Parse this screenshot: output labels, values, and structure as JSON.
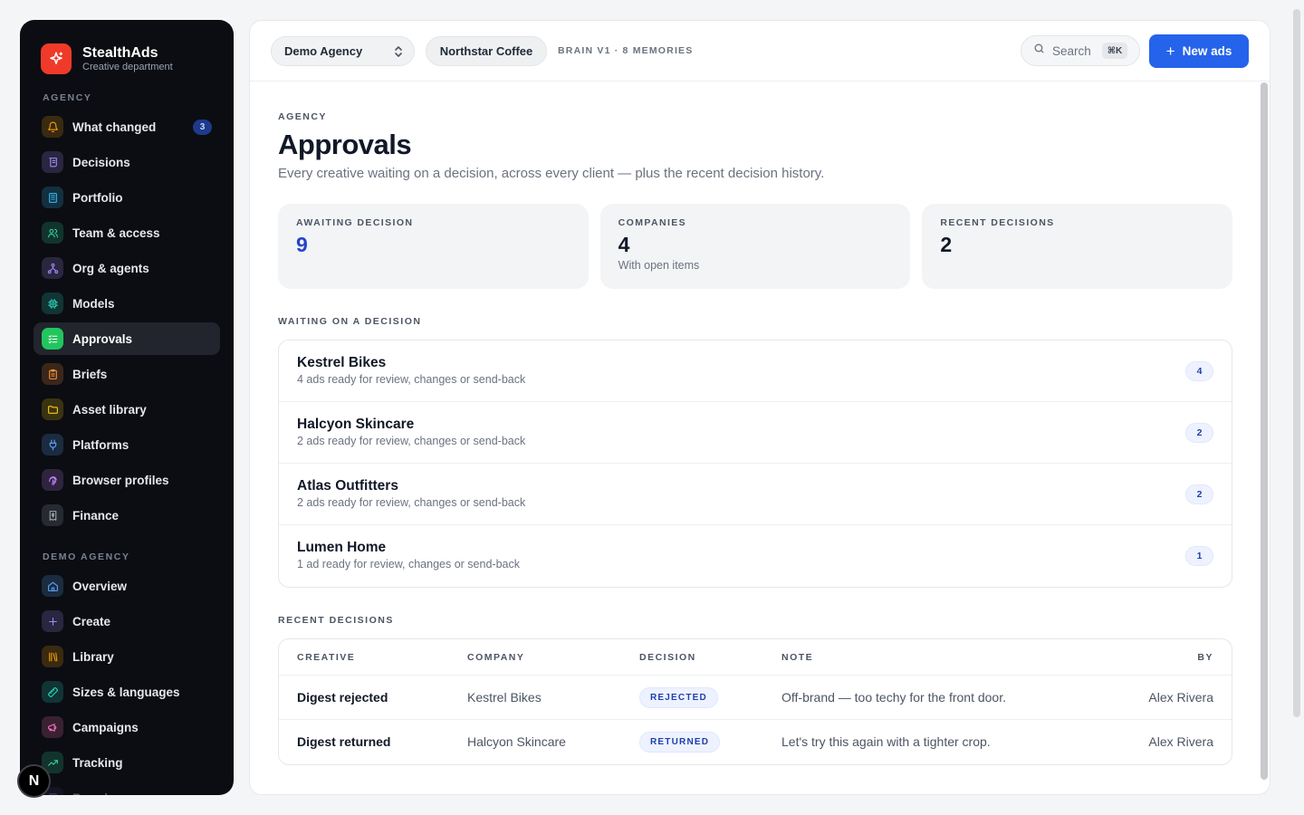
{
  "brand": {
    "name": "StealthAds",
    "subtitle": "Creative department",
    "color": "#ef3a2a"
  },
  "sidebar": {
    "agency_label": "AGENCY",
    "agency_items": [
      {
        "label": "What changed",
        "icon": "bell-icon",
        "color": "#f59e0b",
        "badge": "3"
      },
      {
        "label": "Decisions",
        "icon": "scroll-icon",
        "color": "#a78bfa"
      },
      {
        "label": "Portfolio",
        "icon": "building-icon",
        "color": "#38bdf8"
      },
      {
        "label": "Team & access",
        "icon": "users-icon",
        "color": "#34d399"
      },
      {
        "label": "Org & agents",
        "icon": "network-icon",
        "color": "#a78bfa"
      },
      {
        "label": "Models",
        "icon": "cpu-icon",
        "color": "#2dd4bf"
      },
      {
        "label": "Approvals",
        "icon": "checklist-icon",
        "color": "#22c55e",
        "active": true
      },
      {
        "label": "Briefs",
        "icon": "clipboard-icon",
        "color": "#fb923c"
      },
      {
        "label": "Asset library",
        "icon": "folder-icon",
        "color": "#facc15"
      },
      {
        "label": "Platforms",
        "icon": "plug-icon",
        "color": "#60a5fa"
      },
      {
        "label": "Browser profiles",
        "icon": "fingerprint-icon",
        "color": "#c084fc"
      },
      {
        "label": "Finance",
        "icon": "receipt-icon",
        "color": "#9ca3af"
      }
    ],
    "workspace_label": "DEMO AGENCY",
    "workspace_items": [
      {
        "label": "Overview",
        "icon": "home-icon",
        "color": "#60a5fa"
      },
      {
        "label": "Create",
        "icon": "plus-icon",
        "color": "#a78bfa"
      },
      {
        "label": "Library",
        "icon": "library-icon",
        "color": "#f59e0b"
      },
      {
        "label": "Sizes & languages",
        "icon": "ruler-icon",
        "color": "#2dd4bf"
      },
      {
        "label": "Campaigns",
        "icon": "megaphone-icon",
        "color": "#f472b6"
      },
      {
        "label": "Tracking",
        "icon": "trend-icon",
        "color": "#34d399"
      },
      {
        "label": "Brand memory",
        "icon": "gem-icon",
        "color": "#a78bfa"
      }
    ]
  },
  "topbar": {
    "agency_select": "Demo Agency",
    "client": "Northstar Coffee",
    "brain_meta": "BRAIN V1 · 8 MEMORIES",
    "search_label": "Search",
    "search_shortcut": "⌘K",
    "new_button": "New ads",
    "accent": "#2563eb"
  },
  "page": {
    "eyebrow": "AGENCY",
    "title": "Approvals",
    "description": "Every creative waiting on a decision, across every client — plus the recent decision history."
  },
  "stats": [
    {
      "label": "AWAITING DECISION",
      "value": "9",
      "sub": ""
    },
    {
      "label": "COMPANIES",
      "value": "4",
      "sub": "With open items"
    },
    {
      "label": "RECENT DECISIONS",
      "value": "2",
      "sub": ""
    }
  ],
  "waiting": {
    "label": "WAITING ON A DECISION",
    "rows": [
      {
        "company": "Kestrel Bikes",
        "detail": "4 ads ready for review, changes or send-back",
        "count": "4"
      },
      {
        "company": "Halcyon Skincare",
        "detail": "2 ads ready for review, changes or send-back",
        "count": "2"
      },
      {
        "company": "Atlas Outfitters",
        "detail": "2 ads ready for review, changes or send-back",
        "count": "2"
      },
      {
        "company": "Lumen Home",
        "detail": "1 ad ready for review, changes or send-back",
        "count": "1"
      }
    ]
  },
  "recent": {
    "label": "RECENT DECISIONS",
    "columns": [
      "CREATIVE",
      "COMPANY",
      "DECISION",
      "NOTE",
      "BY"
    ],
    "rows": [
      {
        "creative": "Digest rejected",
        "company": "Kestrel Bikes",
        "decision": "REJECTED",
        "note": "Off-brand — too techy for the front door.",
        "by": "Alex Rivera"
      },
      {
        "creative": "Digest returned",
        "company": "Halcyon Skincare",
        "decision": "RETURNED",
        "note": "Let's try this again with a tighter crop.",
        "by": "Alex Rivera"
      }
    ]
  },
  "dev_indicator": "N"
}
